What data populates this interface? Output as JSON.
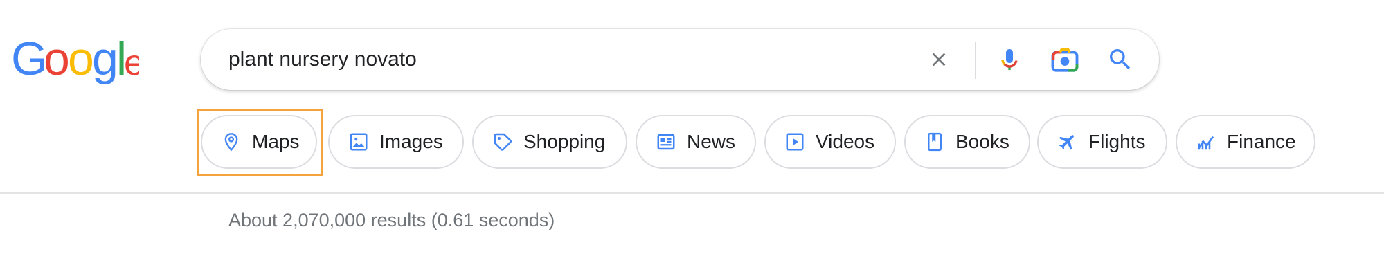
{
  "logo": {
    "text": "Google",
    "letters": [
      "G",
      "o",
      "o",
      "g",
      "l",
      "e"
    ],
    "colors": [
      "#4285F4",
      "#EA4335",
      "#FBBC05",
      "#4285F4",
      "#34A853",
      "#EA4335"
    ]
  },
  "search": {
    "query": "plant nursery novato",
    "icons": {
      "clear": "close-icon",
      "voice": "microphone-icon",
      "lens": "camera-lens-icon",
      "submit": "search-icon"
    }
  },
  "chips": [
    {
      "label": "Maps",
      "icon": "map-pin-icon",
      "highlighted": true
    },
    {
      "label": "Images",
      "icon": "image-icon"
    },
    {
      "label": "Shopping",
      "icon": "tag-icon"
    },
    {
      "label": "News",
      "icon": "newspaper-icon"
    },
    {
      "label": "Videos",
      "icon": "play-icon"
    },
    {
      "label": "Books",
      "icon": "book-icon"
    },
    {
      "label": "Flights",
      "icon": "airplane-icon"
    },
    {
      "label": "Finance",
      "icon": "chart-icon"
    }
  ],
  "result_stats": "About 2,070,000 results (0.61 seconds)",
  "colors": {
    "chip_icon": "#4285F4",
    "highlight": "#f4a43a",
    "text": "#202124",
    "muted": "#70757a"
  }
}
